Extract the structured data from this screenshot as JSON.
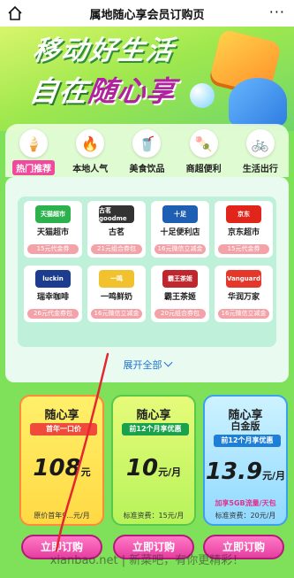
{
  "topbar": {
    "title": "属地随心享会员订购页",
    "more": "···"
  },
  "hero": {
    "line1": "移动好生活",
    "line2_prefix": "自在",
    "line2_highlight": "随心享"
  },
  "categories": [
    {
      "label": "热门推荐",
      "icon": "🍦"
    },
    {
      "label": "本地人气",
      "icon": "🔥"
    },
    {
      "label": "美食饮品",
      "icon": "🥤"
    },
    {
      "label": "商超便利",
      "icon": "🍡"
    },
    {
      "label": "生活出行",
      "icon": "🚲"
    }
  ],
  "brands": [
    {
      "name": "天猫超市",
      "logo_text": "天猫超市",
      "logo_color": "#2bb24c",
      "coupon": "15元代金券"
    },
    {
      "name": "古茗",
      "logo_text": "古茗 goodme",
      "logo_color": "#333333",
      "coupon": "21元组合券包"
    },
    {
      "name": "十足便利店",
      "logo_text": "十足",
      "logo_color": "#1e5fb3",
      "coupon": "16元微信立减金"
    },
    {
      "name": "京东超市",
      "logo_text": "京东",
      "logo_color": "#e1251b",
      "coupon": "15元代金券"
    },
    {
      "name": "瑞幸咖啡",
      "logo_text": "luckin",
      "logo_color": "#1c3d8f",
      "coupon": "26元代金券包"
    },
    {
      "name": "一鸣鲜奶",
      "logo_text": "一鸣",
      "logo_color": "#f2c12e",
      "coupon": "16元微信立减金"
    },
    {
      "name": "霸王茶姬",
      "logo_text": "霸王茶姬",
      "logo_color": "#c0262d",
      "coupon": "20元组合券包"
    },
    {
      "name": "华润万家",
      "logo_text": "Vanguard",
      "logo_color": "#e5382b",
      "coupon": "16元微信立减金"
    }
  ],
  "expand_label": "展开全部",
  "plans": [
    {
      "title": "随心享",
      "subtitle": "",
      "tag": "首年一口价",
      "price": "108",
      "unit": "元",
      "standard": "原价首年9...元/月"
    },
    {
      "title": "随心享",
      "subtitle": "",
      "tag": "前12个月享优惠",
      "price": "10",
      "unit": "元/月",
      "standard": "标准资费：15元/月"
    },
    {
      "title": "随心享",
      "subtitle": "白金版",
      "tag": "前12个月享优惠",
      "price": "13.9",
      "unit": "元/月",
      "extra": "加享5GB流量/天包",
      "standard": "标准资费：20元/月"
    }
  ],
  "buttons": {
    "b1": "立即订购",
    "b2": "立即订购",
    "b3": "立即订购"
  },
  "watermark": "xianbao.net | 新菜吧，有你更精彩！"
}
